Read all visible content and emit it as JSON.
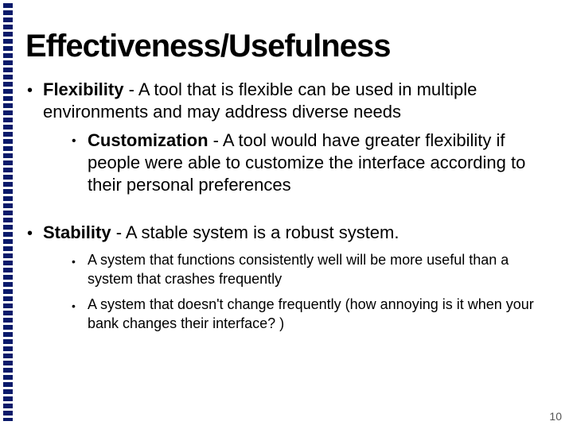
{
  "title": "Effectiveness/Usefulness",
  "items": [
    {
      "label": "Flexibility",
      "desc": " - A tool that is flexible can be used in multiple environments and may address diverse needs",
      "sub": [
        {
          "label": "Customization",
          "desc": " - A tool would have greater flexibility if people were able to customize the interface according to their personal preferences",
          "emphLabel": true,
          "emphAll": true
        }
      ]
    },
    {
      "label": "Stability",
      "desc": " - A stable system is a robust system.",
      "sub": [
        {
          "label": "",
          "desc": "A system that functions consistently well will be more useful than a system that crashes frequently",
          "small": true
        },
        {
          "label": "",
          "desc": "A system that doesn't change frequently (how annoying is it when your bank changes their interface? )",
          "small": true
        }
      ]
    }
  ],
  "pageNumber": "10"
}
